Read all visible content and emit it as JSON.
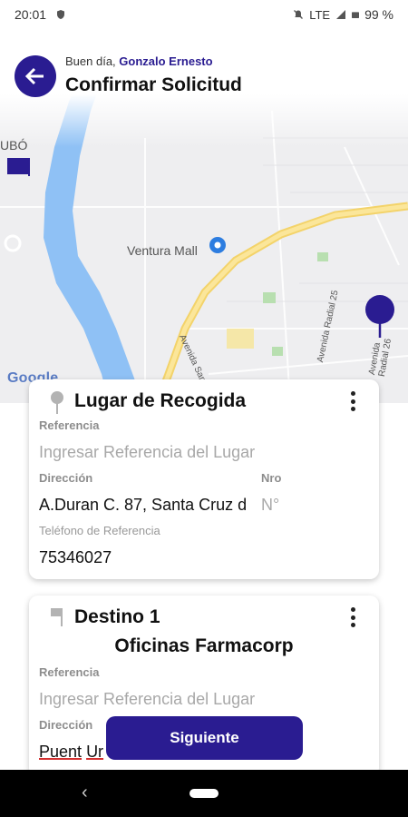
{
  "status_bar": {
    "time": "20:01",
    "network": "LTE",
    "battery": "99 %"
  },
  "header": {
    "greeting_prefix": "Buen día, ",
    "user_name": "Gonzalo Ernesto",
    "title": "Confirmar Solicitud"
  },
  "map": {
    "labels": {
      "ubo": "UBÓ",
      "mall": "Ventura Mall",
      "street_san_martin": "Avenida San Martín",
      "street_radial_25": "Avenida Radial 25",
      "street_radial_26": "Avenida Radial 26",
      "google": "Google"
    },
    "colors": {
      "water": "#8fc1f5",
      "highway": "#f7dc7a",
      "pin": "#2a1c91"
    }
  },
  "pickup_card": {
    "title": "Lugar de Recogida",
    "icon": "map-pin-icon",
    "reference_label": "Referencia",
    "reference_placeholder": "Ingresar Referencia del Lugar",
    "address_label": "Dirección",
    "address_value": "A.Duran C. 87, Santa Cruz d",
    "nro_label": "Nro",
    "nro_placeholder": "N°",
    "phone_label": "Teléfono de Referencia",
    "phone_value": "75346027"
  },
  "destination_card": {
    "title": "Destino 1",
    "subtitle": "Oficinas Farmacorp",
    "icon": "flag-icon",
    "reference_label": "Referencia",
    "reference_placeholder": "Ingresar Referencia del Lugar",
    "address_label": "Dirección",
    "address_value_part1": "Puent",
    "address_value_part2": "Ur"
  },
  "actions": {
    "next_label": "Siguiente"
  },
  "nav": {
    "back_glyph": "‹"
  }
}
